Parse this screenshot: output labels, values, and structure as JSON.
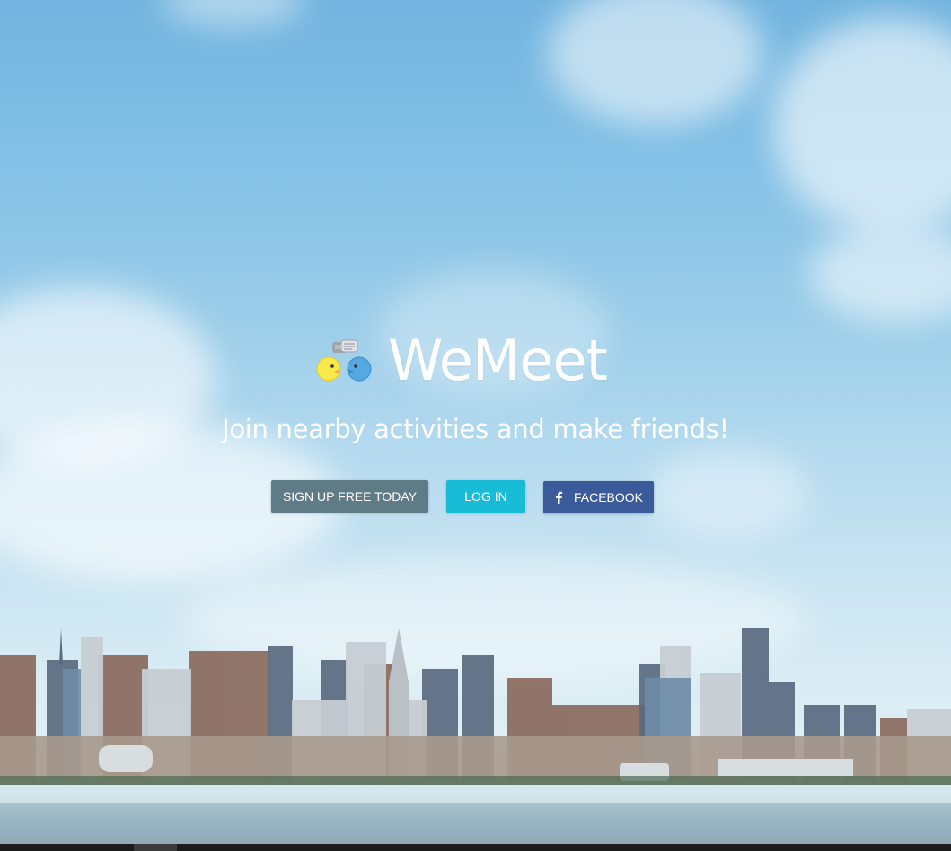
{
  "brand": {
    "name": "WeMeet",
    "logo_icon": "chat-bubbles-faces-icon"
  },
  "hero": {
    "tagline": "Join nearby activities and make friends!"
  },
  "actions": {
    "signup_label": "SIGN UP FREE TODAY",
    "login_label": "LOG IN",
    "facebook_label": "FACEBOOK",
    "facebook_icon": "facebook-f-icon"
  },
  "colors": {
    "signup": "#5e7b86",
    "login": "#18bcd6",
    "facebook": "#3b5a9a",
    "text": "#ffffff"
  }
}
